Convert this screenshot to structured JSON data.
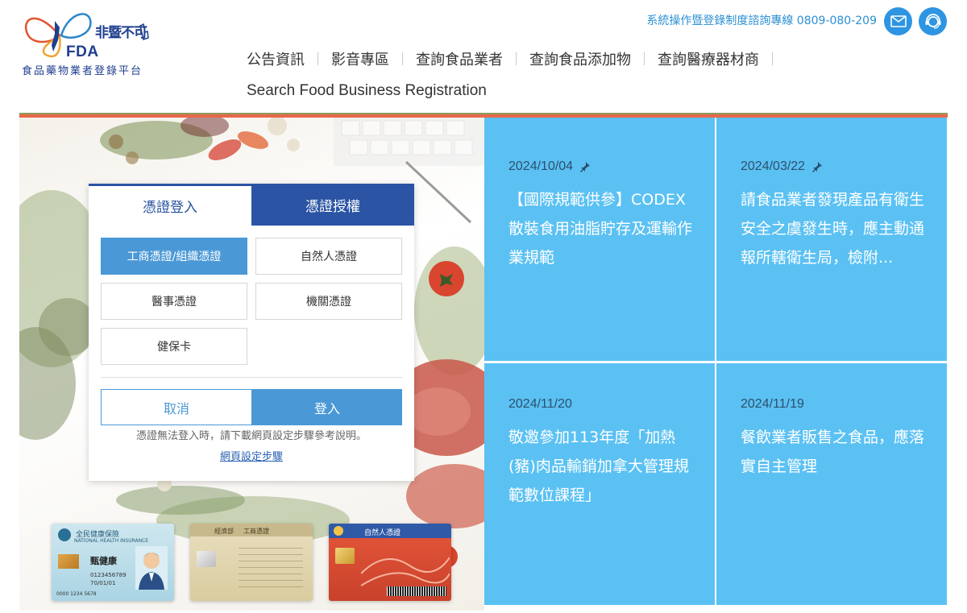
{
  "header": {
    "logo": {
      "slogan": "非暨不可",
      "fda": "FDA",
      "subtitle": "食品藥物業者登錄平台"
    },
    "hotline": "系統操作暨登錄制度諮詢專線 0809-080-209",
    "icons": {
      "mail": "mail-icon",
      "service": "customer-service-icon"
    },
    "nav": [
      {
        "label": "公告資訊"
      },
      {
        "label": "影音專區"
      },
      {
        "label": "查詢食品業者"
      },
      {
        "label": "查詢食品添加物"
      },
      {
        "label": "查詢醫療器材商"
      }
    ],
    "nav_sub": "Search Food Business Registration",
    "colors": {
      "accent_line": "#e8684a",
      "olive_line": "#8c9c5e",
      "tile": "#5bc1f3"
    }
  },
  "login": {
    "tabs": [
      {
        "label": "憑證登入",
        "active": true
      },
      {
        "label": "憑證授權",
        "active": false
      }
    ],
    "cert_options": [
      {
        "label": "工商憑證/組織憑證",
        "active": true
      },
      {
        "label": "自然人憑證",
        "active": false
      },
      {
        "label": "醫事憑證",
        "active": false
      },
      {
        "label": "機關憑證",
        "active": false
      },
      {
        "label": "健保卡",
        "active": false
      }
    ],
    "cancel_label": "取消",
    "login_label": "登入",
    "notice": "憑證無法登入時，請下載網頁設定步驟參考說明。",
    "help_link": "網頁設定步驟"
  },
  "cards": {
    "health": {
      "title": "全民健康保險",
      "subtitle": "NATIONAL HEALTH INSURANCE",
      "name": "甄健康",
      "number": "0123456789",
      "date": "70/01/01",
      "card_no": "0000 1234 5678"
    },
    "biz": {
      "issuer": "經濟部",
      "title": "工商憑證"
    },
    "natural": {
      "title": "自然人憑證"
    }
  },
  "news": [
    {
      "date": "2024/10/04",
      "pinned": true,
      "title": "【國際規範供參】CODEX散裝食用油脂貯存及運輸作業規範"
    },
    {
      "date": "2024/03/22",
      "pinned": true,
      "title": "請食品業者發現產品有衛生安全之虞發生時，應主動通報所轄衛生局，檢附..."
    },
    {
      "date": "2024/11/20",
      "pinned": false,
      "title": "敬邀參加113年度「加熱(豬)肉品輸銷加拿大管理規範數位課程」"
    },
    {
      "date": "2024/11/19",
      "pinned": false,
      "title": "餐飲業者販售之食品，應落實自主管理"
    }
  ]
}
